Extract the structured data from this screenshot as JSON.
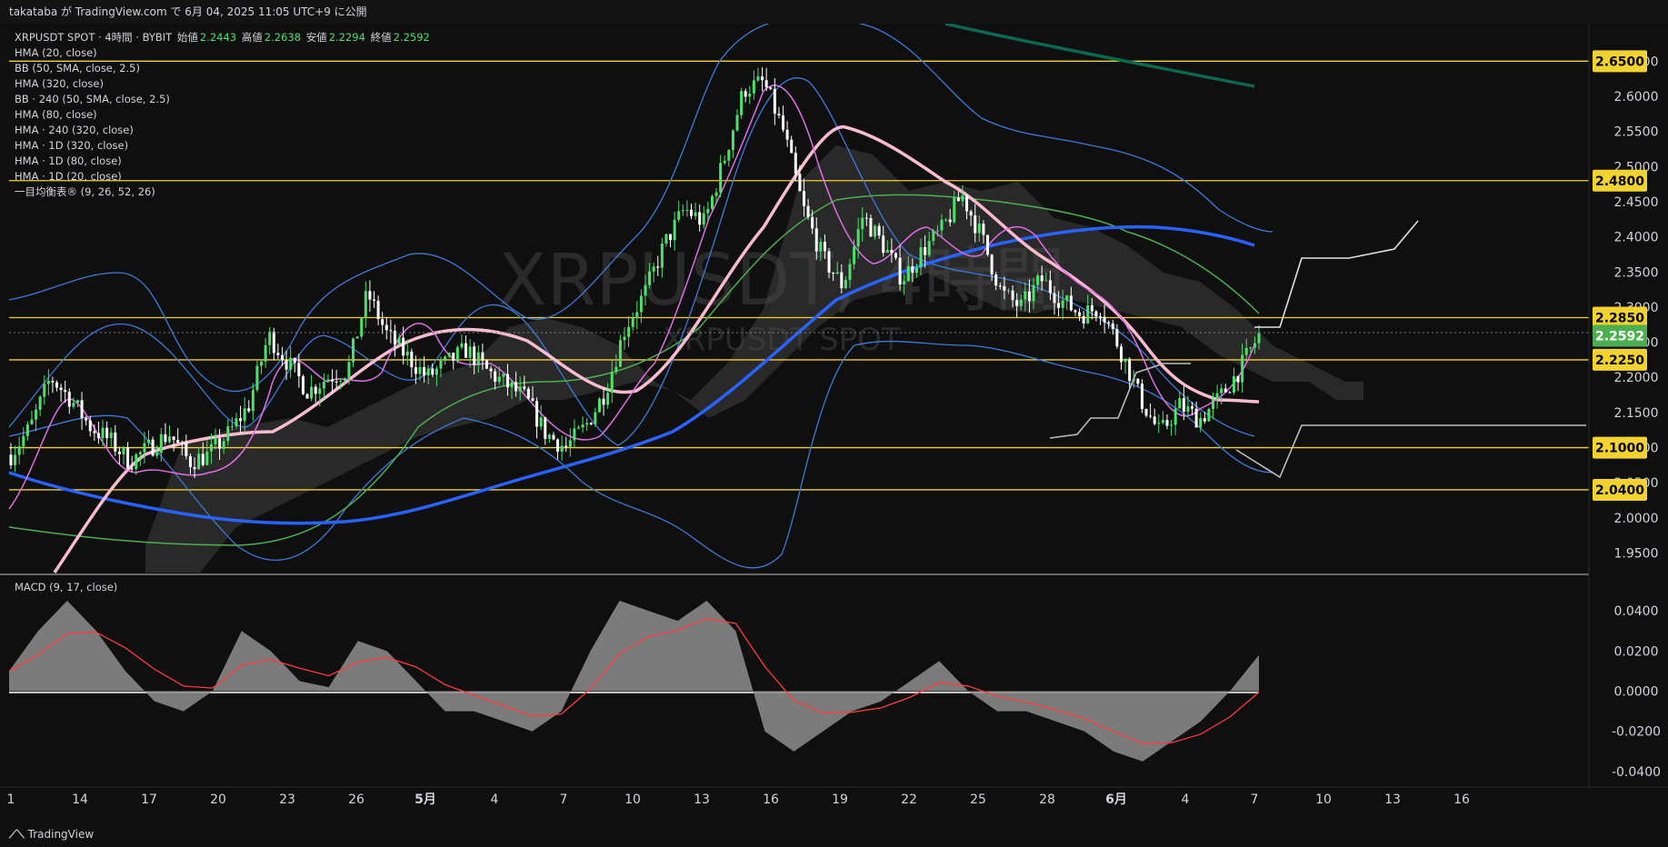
{
  "header": {
    "publish_text": "takataba が TradingView.com で 6月 04, 2025 11:05 UTC+9 に公開"
  },
  "legend": {
    "symbol": "XRPUSDT SPOT · 4時間 · BYBIT",
    "ohlc": [
      {
        "label": "始値",
        "value": "2.2443"
      },
      {
        "label": "高値",
        "value": "2.2638"
      },
      {
        "label": "安値",
        "value": "2.2294"
      },
      {
        "label": "終値",
        "value": "2.2592"
      }
    ],
    "indicators": [
      "HMA (20, close)",
      "BB (50, SMA, close, 2.5)",
      "HMA (320, close)",
      "BB · 240 (50, SMA, close, 2.5)",
      "HMA (80, close)",
      "HMA · 240 (320, close)",
      "HMA · 1D (320, close)",
      "HMA · 1D (80, close)",
      "HMA · 1D (20, close)",
      "一目均衡表® (9, 26, 52, 26)"
    ],
    "macd_label": "MACD (9, 17, close)"
  },
  "watermark": {
    "main": "XRPUSDT, 4時間",
    "sub": "XRPUSDT SPOT"
  },
  "footer": {
    "brand": "TradingView"
  },
  "colors": {
    "bg": "#0f0f0f",
    "up": "#4ee06a",
    "down": "#ffffff",
    "level": "#f2d22e",
    "hma_blue": "#2962ff",
    "hma_pink": "#f8bbd0",
    "bb": "#3d7ad8",
    "green_ma": "#4caf50",
    "current": "#4caf50"
  },
  "chart_data": [
    {
      "type": "candlestick",
      "title": "XRPUSDT SPOT · 4時間 · BYBIT",
      "ylim": [
        1.93,
        2.675
      ],
      "y_ticks": [
        "1.9500",
        "2.0000",
        "2.0500",
        "2.1000",
        "2.1500",
        "2.2000",
        "2.2500",
        "2.3000",
        "2.3500",
        "2.4000",
        "2.4500",
        "2.5000",
        "2.5500",
        "2.6000",
        "2.6500"
      ],
      "x_tick_labels": [
        "1",
        "14",
        "17",
        "20",
        "23",
        "26",
        "5月",
        "4",
        "7",
        "10",
        "13",
        "16",
        "19",
        "22",
        "25",
        "28",
        "6月",
        "4",
        "7",
        "10",
        "13",
        "16"
      ],
      "current_price": "2.2592",
      "horizontal_levels": [
        "2.6500",
        "2.4800",
        "2.2850",
        "2.2250",
        "2.1000",
        "2.0400"
      ],
      "close_path_approx": [
        2.09,
        2.13,
        2.2,
        2.17,
        2.13,
        2.11,
        2.08,
        2.1,
        2.12,
        2.08,
        2.09,
        2.12,
        2.16,
        2.26,
        2.22,
        2.18,
        2.2,
        2.21,
        2.32,
        2.26,
        2.23,
        2.2,
        2.22,
        2.24,
        2.21,
        2.19,
        2.17,
        2.12,
        2.1,
        2.13,
        2.18,
        2.27,
        2.32,
        2.39,
        2.44,
        2.42,
        2.51,
        2.61,
        2.62,
        2.55,
        2.44,
        2.37,
        2.33,
        2.43,
        2.39,
        2.34,
        2.38,
        2.41,
        2.46,
        2.4,
        2.32,
        2.3,
        2.34,
        2.31,
        2.29,
        2.3,
        2.24,
        2.17,
        2.12,
        2.16,
        2.14,
        2.17,
        2.21,
        2.26
      ],
      "series": [
        {
          "name": "HMA (320, close)",
          "approx": [
            2.1,
            2.06,
            2.03,
            2.02,
            2.02,
            2.04,
            2.07,
            2.09,
            2.11,
            2.14,
            2.21,
            2.28,
            2.35,
            2.38,
            2.4,
            2.4,
            2.38
          ]
        },
        {
          "name": "HMA · 1D (20, close)",
          "approx": [
            1.96,
            2.06,
            2.11,
            2.13,
            2.17,
            2.21,
            2.23,
            2.2,
            2.17,
            2.24,
            2.42,
            2.53,
            2.51,
            2.47,
            2.42,
            2.36,
            2.28,
            2.19,
            2.17
          ]
        }
      ]
    },
    {
      "type": "area",
      "title": "MACD (9, 17, close)",
      "ylim": [
        -0.045,
        0.05
      ],
      "y_ticks": [
        "0.0400",
        "0.0200",
        "0.0000",
        "-0.0200",
        "-0.0400"
      ],
      "macd_approx": [
        0.01,
        0.03,
        0.045,
        0.03,
        0.01,
        -0.005,
        -0.01,
        0.0,
        0.03,
        0.02,
        0.005,
        0.002,
        0.025,
        0.02,
        0.005,
        -0.01,
        -0.01,
        -0.015,
        -0.02,
        -0.01,
        0.02,
        0.045,
        0.04,
        0.035,
        0.045,
        0.03,
        -0.02,
        -0.03,
        -0.02,
        -0.01,
        -0.005,
        0.005,
        0.015,
        0.0,
        -0.01,
        -0.01,
        -0.015,
        -0.02,
        -0.03,
        -0.035,
        -0.025,
        -0.015,
        0.0,
        0.018
      ]
    }
  ]
}
